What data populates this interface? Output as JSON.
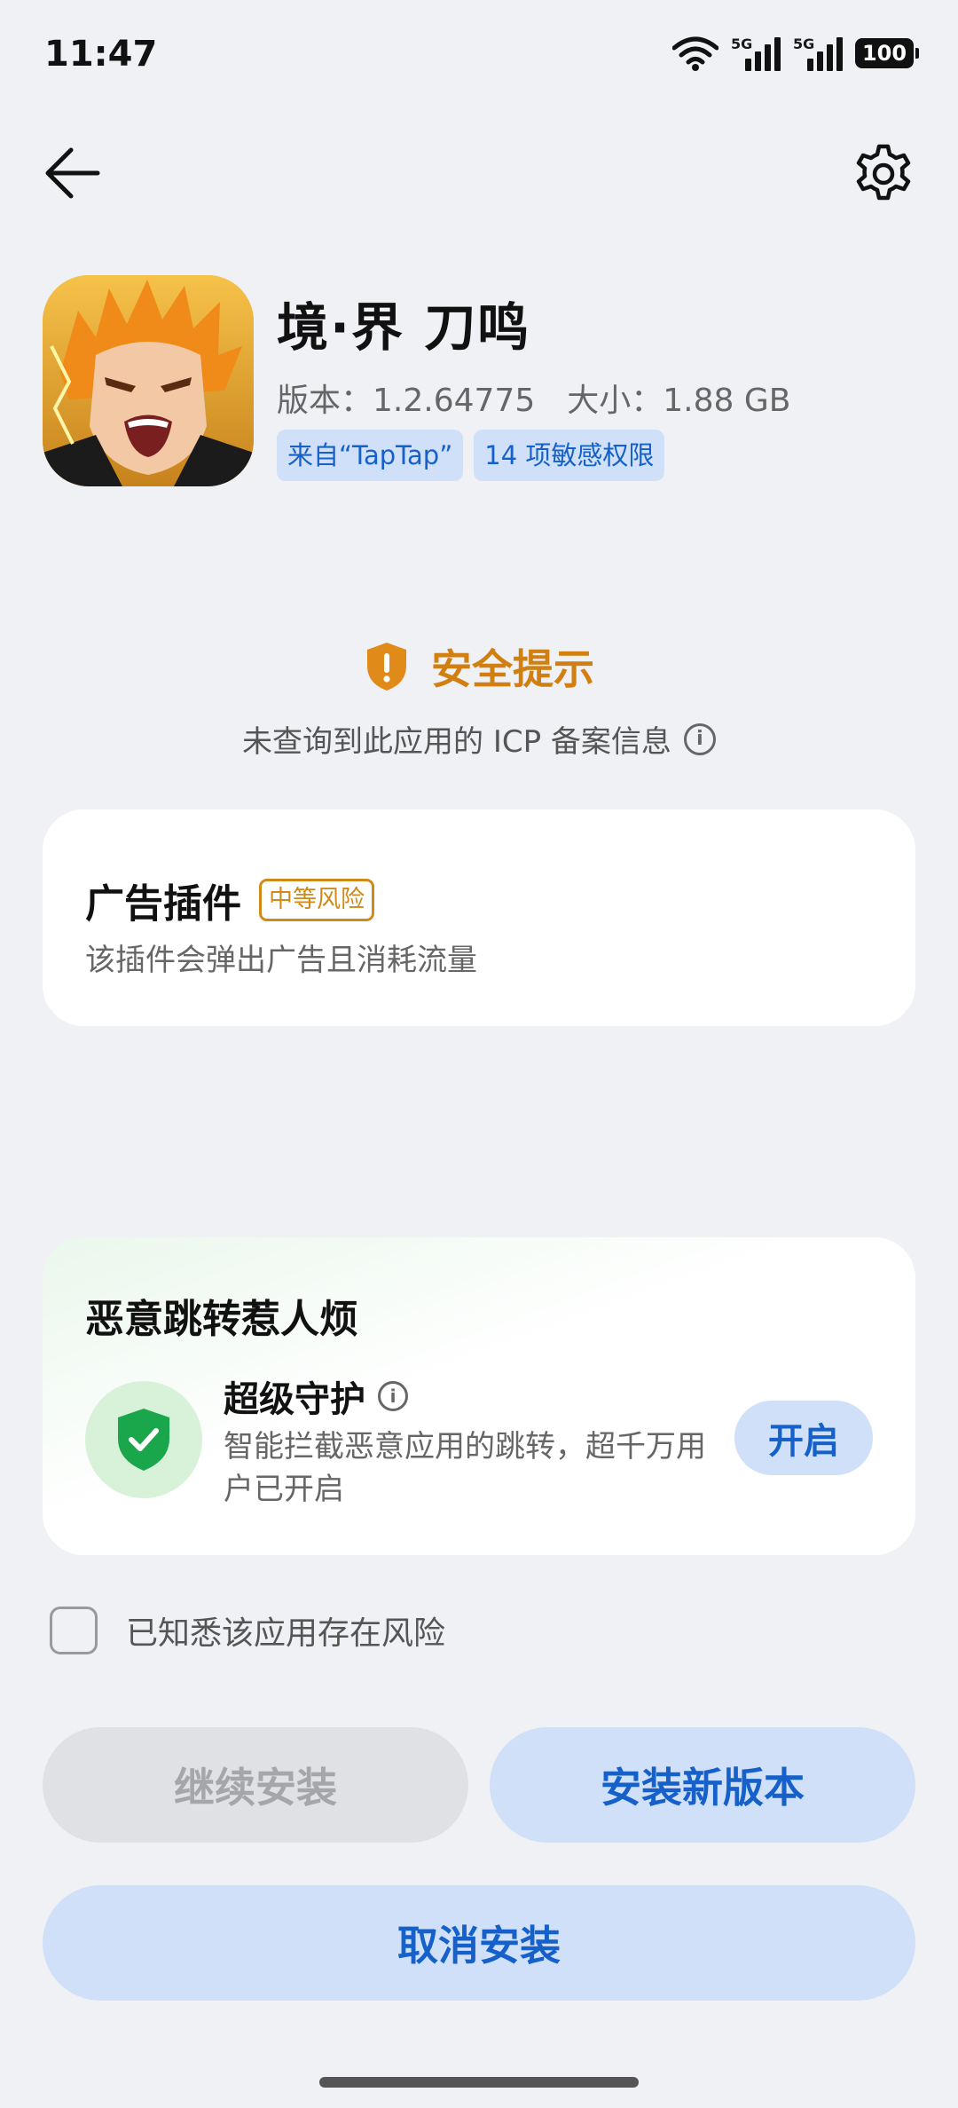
{
  "status_bar": {
    "time": "11:47",
    "sim1_label": "5G",
    "sim2_label": "5G",
    "battery": "100"
  },
  "app": {
    "name": "境·界 刀鸣",
    "version": "版本：1.2.64775",
    "size": "大小：1.88 GB",
    "tags": [
      "来自“TapTap”",
      "14 项敏感权限"
    ]
  },
  "safety": {
    "title": "安全提示",
    "subtitle": "未查询到此应用的 ICP 备案信息"
  },
  "ad_plugin": {
    "title": "广告插件",
    "risk": "中等风险",
    "description": "该插件会弹出广告且消耗流量"
  },
  "guard": {
    "heading": "恶意跳转惹人烦",
    "title": "超级守护",
    "description": "智能拦截恶意应用的跳转，超千万用户已开启",
    "enable_label": "开启"
  },
  "acknowledge": {
    "label": "已知悉该应用存在风险",
    "checked": false
  },
  "buttons": {
    "continue": "继续安装",
    "new_version": "安装新版本",
    "cancel": "取消安装"
  },
  "colors": {
    "accent": "#1560c9",
    "warning": "#d27f12",
    "safe": "#1aa64a",
    "background": "#f0f1f5"
  },
  "icons": [
    "back-arrow-icon",
    "gear-icon",
    "shield-warning-icon",
    "info-icon",
    "shield-check-icon",
    "wifi-icon",
    "signal-icon",
    "battery-icon"
  ]
}
